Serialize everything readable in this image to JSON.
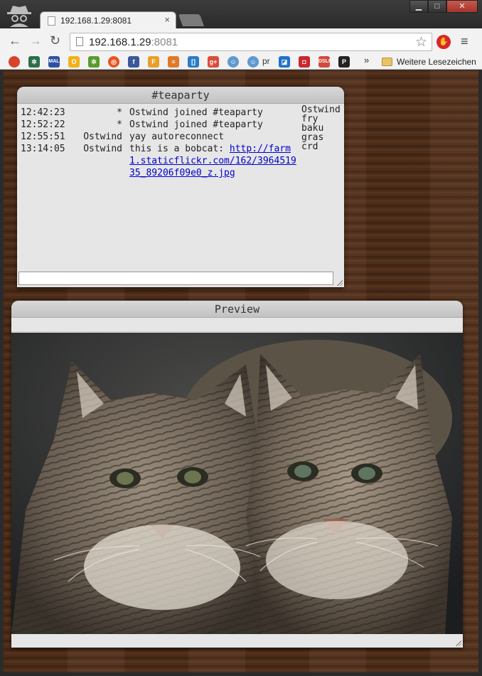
{
  "browser": {
    "tab_title": "192.168.1.29:8081",
    "tab_close": "×",
    "url_host": "192.168.1.29",
    "url_port": ":8081",
    "bookmark_overflow": "»",
    "bookmark_folder": "Weitere Lesezeichen",
    "bookmark_pr": "pr",
    "window_buttons": [
      "minimize",
      "maximize",
      "close"
    ]
  },
  "irc": {
    "title": "#teaparty",
    "messages": [
      {
        "time": "12:42:23",
        "nick": "*",
        "text": "Ostwind joined #teaparty"
      },
      {
        "time": "12:52:22",
        "nick": "*",
        "text": "Ostwind joined #teaparty"
      },
      {
        "time": "12:55:51",
        "nick": "Ostwind",
        "text": "yay autoreconnect"
      },
      {
        "time": "13:14:05",
        "nick": "Ostwind",
        "text": "this is a bobcat: ",
        "link": "http://farm1.staticflickr.com/162/396451935_89206f09e0_z.jpg"
      }
    ],
    "users": [
      "Ostwind",
      "fry",
      "baku",
      "gras",
      "crd"
    ],
    "input_value": ""
  },
  "preview": {
    "title": "Preview",
    "image_subject": "two bobcats"
  },
  "colors": {
    "wood": "#4f2e1a",
    "panel": "#e6e6e6",
    "link": "#0000cc",
    "chrome_toolbar": "#f2f2f2"
  }
}
